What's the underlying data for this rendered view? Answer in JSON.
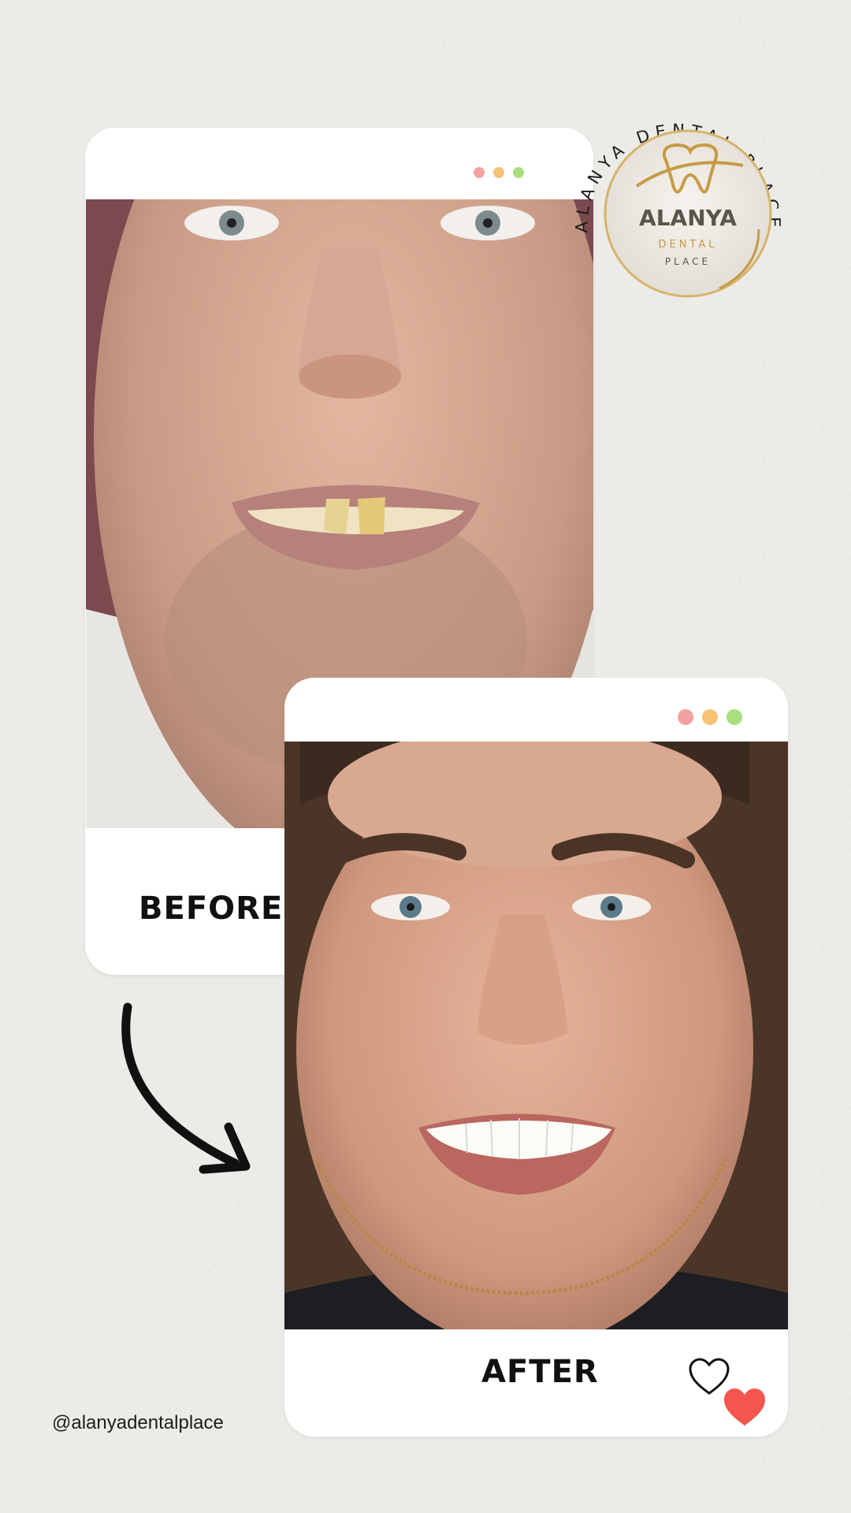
{
  "before_card": {
    "label": "BEFORE",
    "dots": [
      "#f4a1a1",
      "#f6c376",
      "#a9df7f"
    ]
  },
  "after_card": {
    "label": "AFTER",
    "dots": [
      "#f4a1a1",
      "#f6c376",
      "#a9df7f"
    ],
    "heart_outline_icon": "heart-outline-icon",
    "heart_filled_icon": "heart-filled-icon",
    "heart_color": "#f2564f"
  },
  "arrow_icon": "curved-arrow-icon",
  "social_handle": "@alanyadentalplace",
  "logo": {
    "arc_text": "ALANYA DENTAL PLACE",
    "name": "ALANYA",
    "line2": "DENTAL",
    "line3": "PLACE",
    "accent_color": "#c79a45"
  }
}
